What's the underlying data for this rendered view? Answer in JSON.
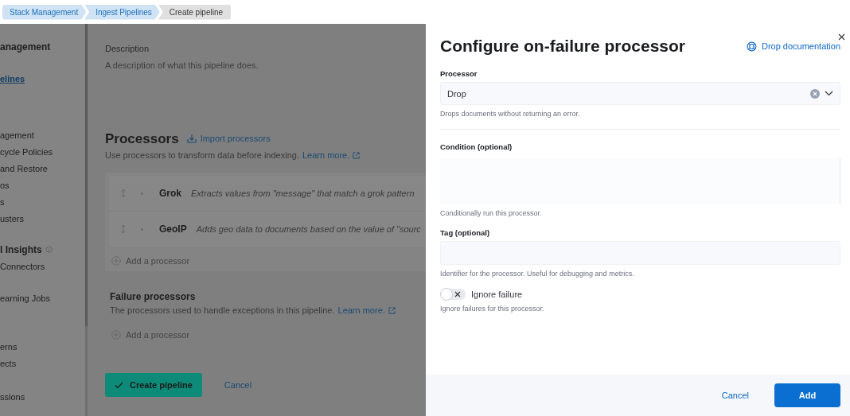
{
  "breadcrumbs": [
    {
      "label": "Stack Management",
      "selected": false
    },
    {
      "label": "Ingest Pipelines",
      "selected": false
    },
    {
      "label": "Create pipeline",
      "selected": true
    }
  ],
  "sidebar": {
    "groups": [
      {
        "items": [
          {
            "label": "anagement",
            "kind": "heading"
          }
        ]
      },
      {
        "items": [
          {
            "label": "elines",
            "kind": "link",
            "selected": true
          }
        ]
      },
      {
        "items": [
          {
            "label": "agement",
            "kind": "link",
            "selected": false
          },
          {
            "label": "cycle Policies",
            "kind": "link",
            "selected": false
          },
          {
            "label": "and Restore",
            "kind": "link",
            "selected": false
          },
          {
            "label": "os",
            "kind": "link",
            "selected": false
          },
          {
            "label": "s",
            "kind": "link",
            "selected": false
          },
          {
            "label": "usters",
            "kind": "link",
            "selected": false
          }
        ]
      },
      {
        "items": [
          {
            "label": "l Insights",
            "kind": "heading"
          },
          {
            "label": "Connectors",
            "kind": "link",
            "selected": false
          }
        ]
      },
      {
        "items": [
          {
            "label": "earning Jobs",
            "kind": "link",
            "selected": false
          }
        ]
      },
      {
        "items": [
          {
            "label": "erns",
            "kind": "link",
            "selected": false
          },
          {
            "label": "ects",
            "kind": "link",
            "selected": false
          }
        ]
      },
      {
        "items": [
          {
            "label": "ssions",
            "kind": "link",
            "selected": false
          }
        ]
      }
    ]
  },
  "form": {
    "description": {
      "label": "Description",
      "placeholder": "A description of what this pipeline does."
    },
    "processors": {
      "title": "Processors",
      "import_link": "Import processors",
      "help": "Use processors to transform data before indexing.",
      "learn_more": "Learn more.",
      "items": [
        {
          "name": "Grok",
          "description": "Extracts values from \"message\" that match a grok pattern"
        },
        {
          "name": "GeoIP",
          "description": "Adds geo data to documents based on the value of \"sourc"
        }
      ],
      "add": "Add a processor"
    },
    "failure_processors": {
      "title": "Failure processors",
      "help": "The processors used to handle exceptions in this pipeline.",
      "learn_more": "Learn more.",
      "add": "Add a processor"
    },
    "buttons": {
      "create": "Create pipeline",
      "cancel": "Cancel"
    }
  },
  "flyout": {
    "title": "Configure on-failure processor",
    "doc_link": "Drop documentation",
    "processor": {
      "label": "Processor",
      "value": "Drop",
      "help": "Drops documents without returning an error."
    },
    "condition": {
      "label": "Condition (optional)",
      "help": "Conditionally run this processor."
    },
    "tag": {
      "label": "Tag (optional)",
      "help": "Identifier for the processor. Useful for debugging and metrics."
    },
    "ignore_failure": {
      "label": "Ignore failure",
      "on": false,
      "help": "Ignore failures for this processor."
    },
    "buttons": {
      "cancel": "Cancel",
      "add": "Add"
    }
  }
}
